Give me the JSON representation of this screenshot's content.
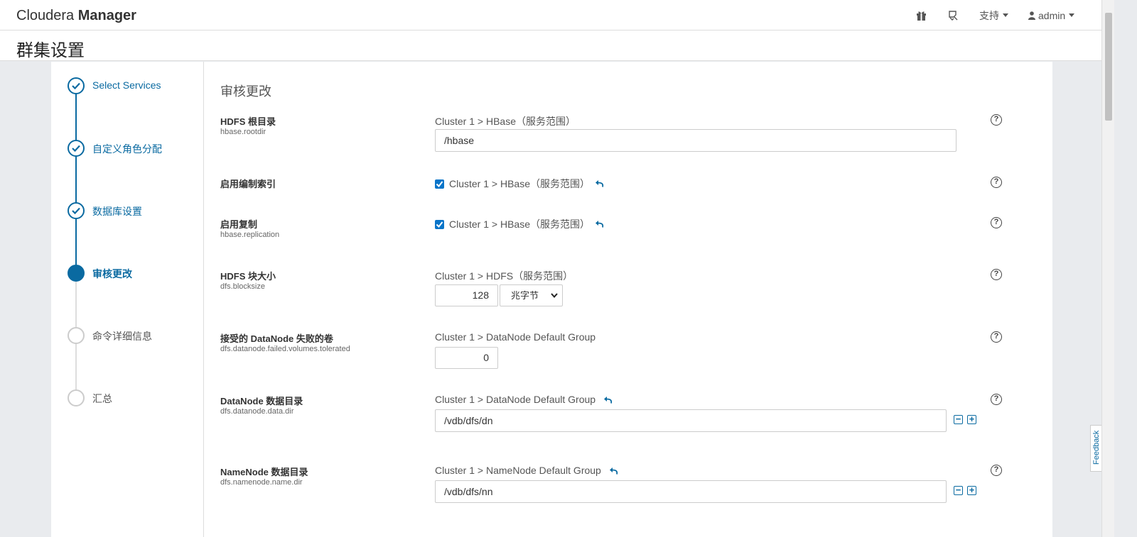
{
  "header": {
    "brand_light": "Cloudera ",
    "brand_bold": "Manager",
    "icons": [
      "gift-icon",
      "ticket-icon"
    ],
    "support_label": "支持",
    "user_label": "admin"
  },
  "page_title": "群集设置",
  "steps": [
    {
      "label": "Select Services",
      "state": "done"
    },
    {
      "label": "自定义角色分配",
      "state": "done"
    },
    {
      "label": "数据库设置",
      "state": "done"
    },
    {
      "label": "审核更改",
      "state": "active"
    },
    {
      "label": "命令详细信息",
      "state": "todo"
    },
    {
      "label": "汇总",
      "state": "todo"
    }
  ],
  "section_title": "审核更改",
  "properties": {
    "hbase_rootdir": {
      "name": "HDFS 根目录",
      "key": "hbase.rootdir",
      "scope": "Cluster 1 > HBase（服务范围）",
      "value": "/hbase"
    },
    "index_replication": {
      "name": "启用编制索引",
      "scope": "Cluster 1 > HBase（服务范围）",
      "checked": true
    },
    "replication": {
      "name": "启用复制",
      "key": "hbase.replication",
      "scope": "Cluster 1 > HBase（服务范围）",
      "checked": true
    },
    "blocksize": {
      "name": "HDFS 块大小",
      "key": "dfs.blocksize",
      "scope": "Cluster 1 > HDFS（服务范围）",
      "value": "128",
      "unit": "兆字节"
    },
    "failed_volumes": {
      "name": "接受的 DataNode 失败的卷",
      "key": "dfs.datanode.failed.volumes.tolerated",
      "scope": "Cluster 1 > DataNode Default Group",
      "value": "0"
    },
    "datanode_dir": {
      "name": "DataNode 数据目录",
      "key": "dfs.datanode.data.dir",
      "scope": "Cluster 1 > DataNode Default Group",
      "value": "/vdb/dfs/dn"
    },
    "namenode_dir": {
      "name": "NameNode 数据目录",
      "key": "dfs.namenode.name.dir",
      "scope": "Cluster 1 > NameNode Default Group",
      "value": "/vdb/dfs/nn"
    }
  },
  "help_glyph": "?",
  "minus_glyph": "−",
  "plus_glyph": "+",
  "feedback_label": "Feedback",
  "colors": {
    "accent": "#0a6aa1",
    "checkbox": "#0a75c9"
  }
}
